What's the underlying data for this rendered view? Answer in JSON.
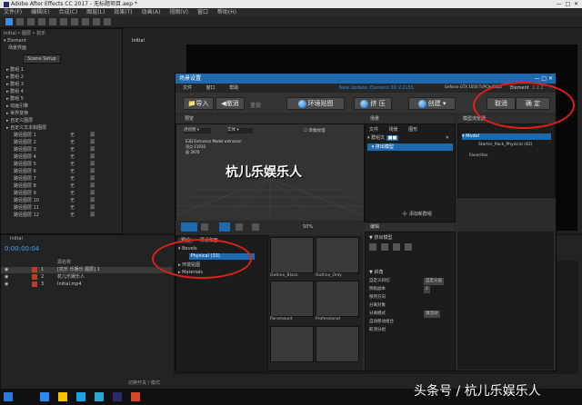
{
  "app": {
    "title": "Adobe After Effects CC 2017 - 无标题项目.aep *",
    "menu": [
      "文件(F)",
      "编辑(E)",
      "合成(C)",
      "图层(L)",
      "效果(T)",
      "动画(A)",
      "视图(V)",
      "窗口",
      "帮助(H)"
    ]
  },
  "left_panel": {
    "tab": "Initial • 图层 • 抗乐",
    "header": "Element",
    "scene_setup": "Scene Setup",
    "section": "场景界面",
    "rows": [
      "群组 1",
      "群组 2",
      "群组 3",
      "群组 4",
      "群组 5",
      "动画引擎",
      "世界变换",
      "自定义图层",
      "自定义文本和图层"
    ],
    "sub_rows": [
      "路径图层 1",
      "路径图层 2",
      "路径图层 3",
      "路径图层 4",
      "路径图层 5",
      "路径图层 6",
      "路径图层 7",
      "路径图层 8",
      "路径图层 9",
      "路径图层 10",
      "路径图层 11",
      "路径图层 12"
    ],
    "col_values": [
      "无",
      "源"
    ]
  },
  "comp_tab": "Initial",
  "timeline": {
    "comp_name": "Initial",
    "timecode": "0:00:00:04",
    "search_placeholder": "",
    "layer_header": "源名称",
    "layers": [
      {
        "num": "1",
        "name": "[抗乐 乐娱乐 图层] 1"
      },
      {
        "num": "2",
        "name": "杭儿乐娱乐人"
      },
      {
        "num": "3",
        "name": "Initial.mp4"
      }
    ],
    "footer": "切换开关 / 模式"
  },
  "dialog": {
    "title": "场景设置",
    "menu": [
      "文件",
      "窗口",
      "帮助"
    ],
    "update_text": "New Update: Element 3D V.2155",
    "gpu_text": "Geforce GTX 1050 Ti/PCIe/SSE2",
    "version_label": "Element",
    "version_value": "2.2.2",
    "toolbar": {
      "import": "导入",
      "undo": "撤消",
      "redo": "重做",
      "env": "环境贴图",
      "extrude": "挤 压",
      "create": "创建",
      "cancel": "取消",
      "ok": "确 定"
    },
    "preview": {
      "title": "预览",
      "camera": "透视图",
      "shading": "实体",
      "scene_texture": "草稿纹理",
      "info": [
        "E3D Extrusion Model extrusion",
        "顶点 11910",
        "面 3970"
      ],
      "zoom": "50%"
    },
    "scene": {
      "title": "场景",
      "tabs": [
        "文件",
        "场景",
        "图形"
      ],
      "group": "群组文",
      "model": "挤出模型",
      "add_group": "添加新群组"
    },
    "model_browser": {
      "title": "模型浏览器",
      "folder": "Model",
      "item": "Starter_Pack_Physical (42)",
      "favorites": "Favorites"
    },
    "presets": {
      "tabs": [
        "预设",
        "预设和面"
      ],
      "folders": [
        "Bevels",
        "环境贴图",
        "Materials"
      ],
      "selected": "Physical (33)",
      "tiles": [
        "Outline_Black",
        "Outline_Only",
        "Paramount",
        "Professional"
      ]
    },
    "edit": {
      "title": "编辑",
      "layer_name": "挤出模型",
      "section": "斜角",
      "rows": [
        {
          "label": "自定义斜切",
          "value": "自定义层"
        },
        {
          "label": "倒角副本",
          "value": "2"
        },
        {
          "label": "保持方向",
          "value": ""
        },
        {
          "label": "分离对象",
          "value": ""
        },
        {
          "label": "分离模式",
          "value": "激活动"
        },
        {
          "label": "自动移动组合",
          "value": ""
        },
        {
          "label": "取消分组",
          "value": ""
        }
      ]
    }
  },
  "watermark_text": "杭儿乐娱乐人",
  "watermark_footer": "头条号 / 杭儿乐娱乐人"
}
